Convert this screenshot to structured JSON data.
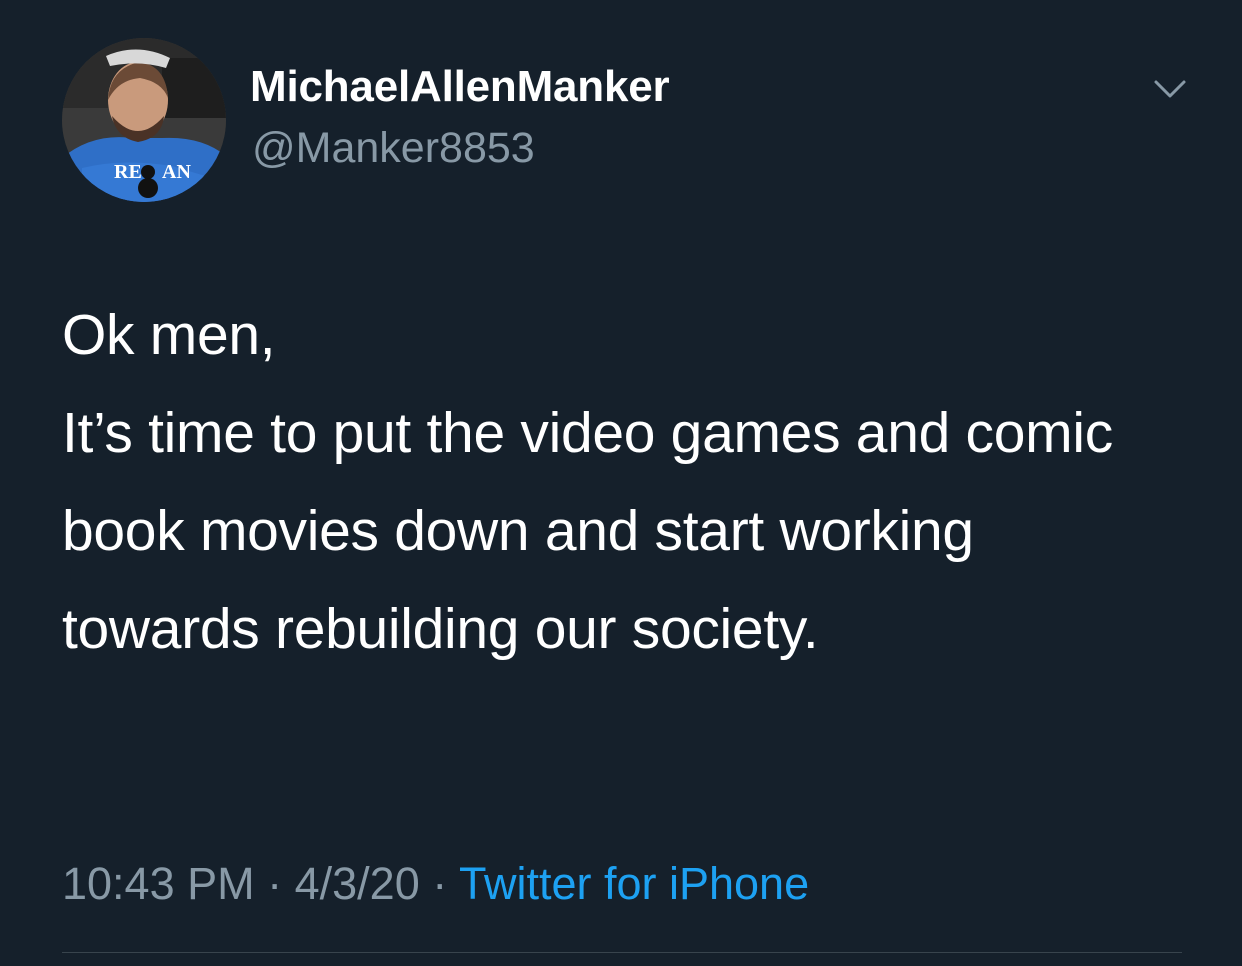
{
  "tweet": {
    "author": {
      "display_name": "MichaelAllenManker",
      "handle": "@Manker8853"
    },
    "text_lines": [
      "Ok men,",
      "It’s time to put the video games and comic book movies down and start working towards rebuilding our society."
    ],
    "meta": {
      "time": "10:43 PM",
      "separator": " · ",
      "date": "4/3/20",
      "source": "Twitter for iPhone"
    },
    "icons": {
      "menu": "chevron-down-icon",
      "avatar": "profile-photo"
    },
    "colors": {
      "background": "#15202b",
      "primary_text": "#ffffff",
      "secondary_text": "#8899a6",
      "accent": "#1da1f2",
      "divider": "#38444d"
    }
  }
}
